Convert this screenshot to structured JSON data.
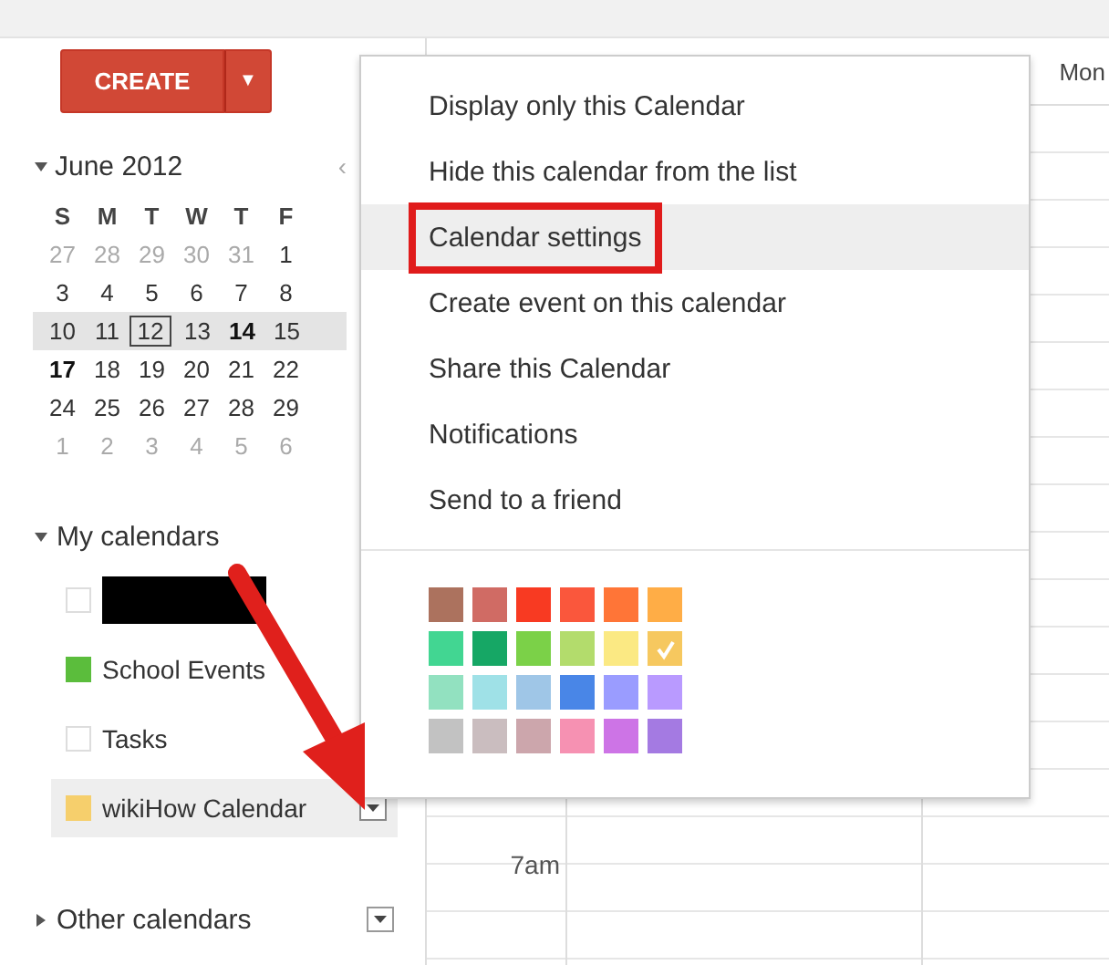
{
  "create_button": {
    "label": "CREATE",
    "caret": "▼"
  },
  "mini_calendar": {
    "title": "June 2012",
    "expanded": true,
    "prev": "‹",
    "weekdays": [
      "S",
      "M",
      "T",
      "W",
      "T",
      "F"
    ],
    "weeks": [
      {
        "selected": false,
        "days": [
          {
            "d": "27",
            "muted": true,
            "bold": false,
            "today": false
          },
          {
            "d": "28",
            "muted": true,
            "bold": false,
            "today": false
          },
          {
            "d": "29",
            "muted": true,
            "bold": false,
            "today": false
          },
          {
            "d": "30",
            "muted": true,
            "bold": false,
            "today": false
          },
          {
            "d": "31",
            "muted": true,
            "bold": false,
            "today": false
          },
          {
            "d": "1",
            "muted": false,
            "bold": false,
            "today": false
          }
        ]
      },
      {
        "selected": false,
        "days": [
          {
            "d": "3",
            "muted": false,
            "bold": false,
            "today": false
          },
          {
            "d": "4",
            "muted": false,
            "bold": false,
            "today": false
          },
          {
            "d": "5",
            "muted": false,
            "bold": false,
            "today": false
          },
          {
            "d": "6",
            "muted": false,
            "bold": false,
            "today": false
          },
          {
            "d": "7",
            "muted": false,
            "bold": false,
            "today": false
          },
          {
            "d": "8",
            "muted": false,
            "bold": false,
            "today": false
          }
        ]
      },
      {
        "selected": true,
        "days": [
          {
            "d": "10",
            "muted": false,
            "bold": false,
            "today": false
          },
          {
            "d": "11",
            "muted": false,
            "bold": false,
            "today": false
          },
          {
            "d": "12",
            "muted": false,
            "bold": false,
            "today": true
          },
          {
            "d": "13",
            "muted": false,
            "bold": false,
            "today": false
          },
          {
            "d": "14",
            "muted": false,
            "bold": true,
            "today": false
          },
          {
            "d": "15",
            "muted": false,
            "bold": false,
            "today": false
          }
        ]
      },
      {
        "selected": false,
        "days": [
          {
            "d": "17",
            "muted": false,
            "bold": true,
            "today": false
          },
          {
            "d": "18",
            "muted": false,
            "bold": false,
            "today": false
          },
          {
            "d": "19",
            "muted": false,
            "bold": false,
            "today": false
          },
          {
            "d": "20",
            "muted": false,
            "bold": false,
            "today": false
          },
          {
            "d": "21",
            "muted": false,
            "bold": false,
            "today": false
          },
          {
            "d": "22",
            "muted": false,
            "bold": false,
            "today": false
          }
        ]
      },
      {
        "selected": false,
        "days": [
          {
            "d": "24",
            "muted": false,
            "bold": false,
            "today": false
          },
          {
            "d": "25",
            "muted": false,
            "bold": false,
            "today": false
          },
          {
            "d": "26",
            "muted": false,
            "bold": false,
            "today": false
          },
          {
            "d": "27",
            "muted": false,
            "bold": false,
            "today": false
          },
          {
            "d": "28",
            "muted": false,
            "bold": false,
            "today": false
          },
          {
            "d": "29",
            "muted": false,
            "bold": false,
            "today": false
          }
        ]
      },
      {
        "selected": false,
        "days": [
          {
            "d": "1",
            "muted": true,
            "bold": false,
            "today": false
          },
          {
            "d": "2",
            "muted": true,
            "bold": false,
            "today": false
          },
          {
            "d": "3",
            "muted": true,
            "bold": false,
            "today": false
          },
          {
            "d": "4",
            "muted": true,
            "bold": false,
            "today": false
          },
          {
            "d": "5",
            "muted": true,
            "bold": false,
            "today": false
          },
          {
            "d": "6",
            "muted": true,
            "bold": false,
            "today": false
          }
        ]
      }
    ]
  },
  "my_calendars": {
    "title": "My calendars",
    "expanded": true,
    "items": [
      {
        "kind": "redacted",
        "checked": false,
        "selected": false
      },
      {
        "kind": "calendar",
        "label": "School Events",
        "checked": true,
        "color": "#5bbd3c",
        "selected": false
      },
      {
        "kind": "calendar",
        "label": "Tasks",
        "checked": false,
        "selected": false
      },
      {
        "kind": "calendar",
        "label": "wikiHow Calendar",
        "checked": true,
        "color": "#f6cf6c",
        "selected": true,
        "menu": true
      }
    ]
  },
  "other_calendars": {
    "title": "Other calendars",
    "expanded": false
  },
  "day_view": {
    "header": "Mon",
    "times": [
      "7am"
    ]
  },
  "context_menu": {
    "items": [
      {
        "label": "Display only this Calendar",
        "selected": false,
        "highlighted": false
      },
      {
        "label": "Hide this calendar from the list",
        "selected": false,
        "highlighted": false
      },
      {
        "label": "Calendar settings",
        "selected": true,
        "highlighted": true
      },
      {
        "label": "Create event on this calendar",
        "selected": false,
        "highlighted": false
      },
      {
        "label": "Share this Calendar",
        "selected": false,
        "highlighted": false
      },
      {
        "label": "Notifications",
        "selected": false,
        "highlighted": false
      },
      {
        "label": "Send to a friend",
        "selected": false,
        "highlighted": false
      }
    ],
    "palette": [
      {
        "color": "#ac725e",
        "selected": false
      },
      {
        "color": "#d06b64",
        "selected": false
      },
      {
        "color": "#f83a22",
        "selected": false
      },
      {
        "color": "#fa573c",
        "selected": false
      },
      {
        "color": "#ff7537",
        "selected": false
      },
      {
        "color": "#ffad46",
        "selected": false
      },
      {
        "color": "#42d692",
        "selected": false
      },
      {
        "color": "#16a765",
        "selected": false
      },
      {
        "color": "#7bd148",
        "selected": false
      },
      {
        "color": "#b3dc6c",
        "selected": false
      },
      {
        "color": "#fbe983",
        "selected": false
      },
      {
        "color": "#f6c85f",
        "selected": true
      },
      {
        "color": "#92e1c0",
        "selected": false
      },
      {
        "color": "#9fe1e7",
        "selected": false
      },
      {
        "color": "#9fc6e7",
        "selected": false
      },
      {
        "color": "#4986e7",
        "selected": false
      },
      {
        "color": "#9a9cff",
        "selected": false
      },
      {
        "color": "#b99aff",
        "selected": false
      },
      {
        "color": "#c2c2c2",
        "selected": false
      },
      {
        "color": "#cabdbf",
        "selected": false
      },
      {
        "color": "#cca6ac",
        "selected": false
      },
      {
        "color": "#f691b2",
        "selected": false
      },
      {
        "color": "#cd74e6",
        "selected": false
      },
      {
        "color": "#a47ae2",
        "selected": false
      }
    ]
  },
  "annotation": {
    "arrow": true
  }
}
